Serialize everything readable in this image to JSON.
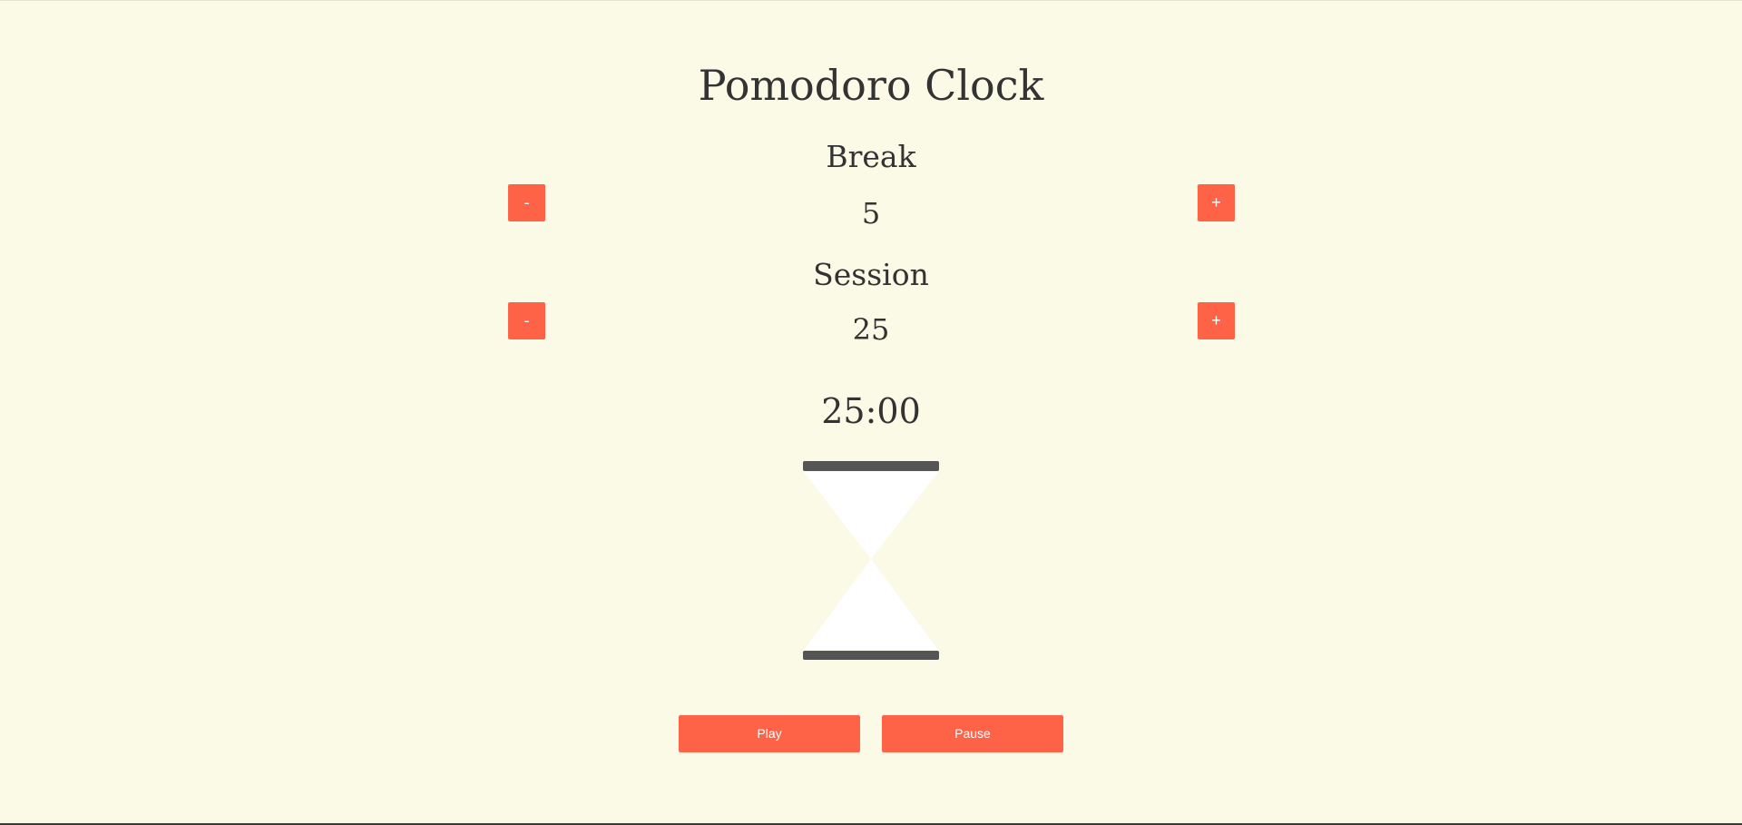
{
  "app": {
    "title": "Pomodoro Clock"
  },
  "break": {
    "label": "Break",
    "value": "5",
    "decrement_label": "-",
    "increment_label": "+"
  },
  "session": {
    "label": "Session",
    "value": "25",
    "decrement_label": "-",
    "increment_label": "+"
  },
  "timer": {
    "display": "25:00"
  },
  "controls": {
    "play_label": "Play",
    "pause_label": "Pause"
  },
  "colors": {
    "background": "#fafae6",
    "accent": "#ff6347",
    "text": "#333333",
    "hourglass_bar": "#555555",
    "hourglass_glass": "#ffffff"
  },
  "icons": {
    "hourglass": "hourglass-icon"
  }
}
